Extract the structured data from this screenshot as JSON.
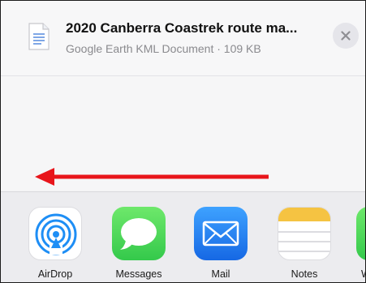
{
  "header": {
    "file_title": "2020 Canberra Coastrek route ma...",
    "file_subtitle": "Google Earth KML Document · 109 KB",
    "close_glyph": "✕"
  },
  "share_apps": [
    {
      "label": "AirDrop",
      "icon": "airdrop-icon"
    },
    {
      "label": "Messages",
      "icon": "messages-icon"
    },
    {
      "label": "Mail",
      "icon": "mail-icon"
    },
    {
      "label": "Notes",
      "icon": "notes-icon"
    },
    {
      "label": "W",
      "icon": "partial-app-icon"
    }
  ],
  "annotation": {
    "arrow_color": "#e8151b",
    "direction": "left"
  },
  "colors": {
    "messages": "#4cd964",
    "mail": "#1f7af0",
    "airdrop": "#1e8ef5",
    "notes_header": "#f5c342"
  }
}
